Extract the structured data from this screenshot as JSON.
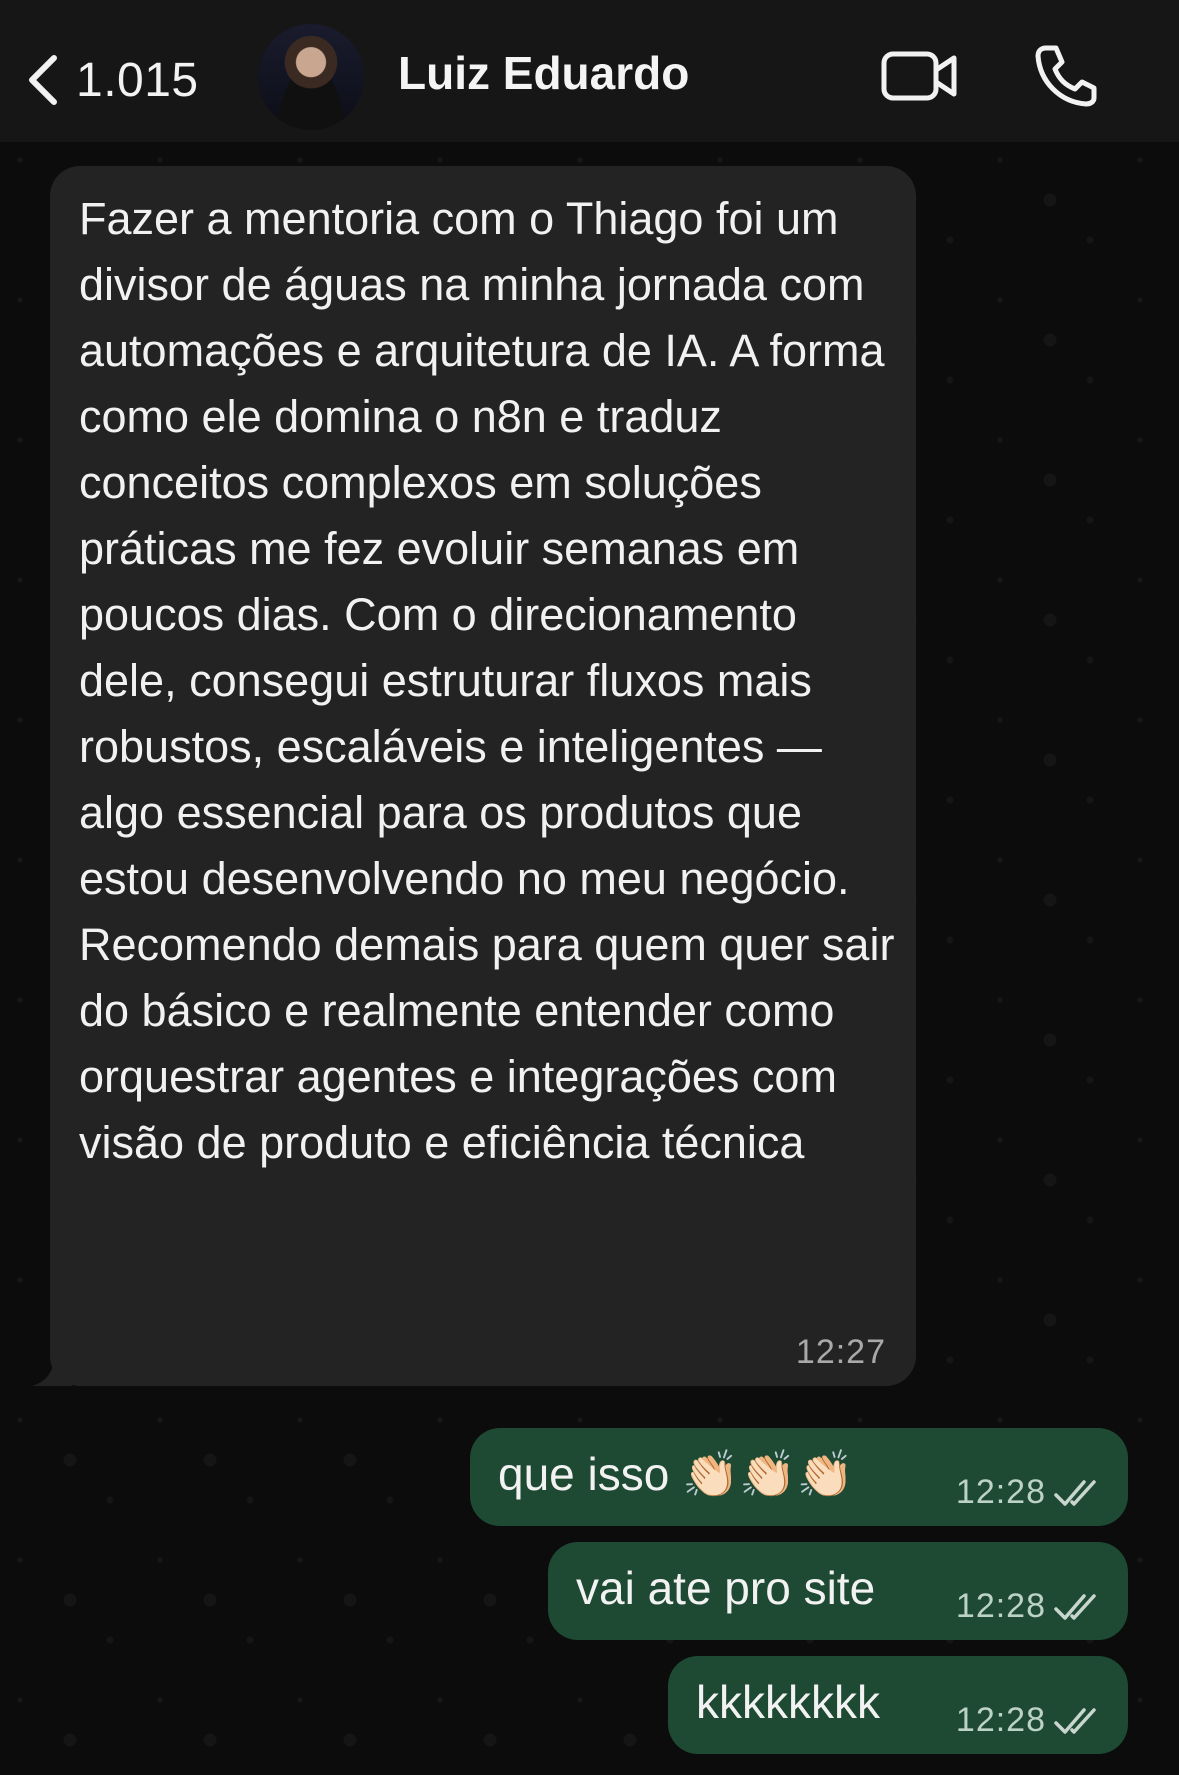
{
  "header": {
    "back_count": "1.015",
    "contact_name": "Luiz Eduardo"
  },
  "icons": {
    "back": "chevron-left-icon",
    "video": "video-camera-icon",
    "phone": "phone-icon",
    "read": "double-check-icon"
  },
  "messages": {
    "incoming": {
      "text": "Fazer a mentoria com o Thiago foi um divisor de águas na minha jornada com automações e arquitetura de IA. A forma como ele domina o n8n e traduz conceitos complexos em soluções práticas me fez evoluir semanas em poucos dias. Com o direcionamento dele, consegui estruturar fluxos mais robustos, escaláveis e inteligentes — algo essencial para os produtos que estou desenvolvendo no meu negócio. Recomendo demais para quem quer sair do básico e realmente entender como orquestrar agentes e integrações com visão de produto e eficiência técnica",
      "time": "12:27"
    },
    "outgoing": [
      {
        "text": "que isso 👏🏻👏🏻👏🏻",
        "time": "12:28"
      },
      {
        "text": "vai ate pro site",
        "time": "12:28"
      },
      {
        "text": "kkkkkkkk",
        "time": "12:28"
      }
    ]
  },
  "colors": {
    "incoming_bubble": "#232323",
    "outgoing_bubble": "#1e4a34",
    "header": "#161616",
    "background": "#0b0b0b"
  }
}
